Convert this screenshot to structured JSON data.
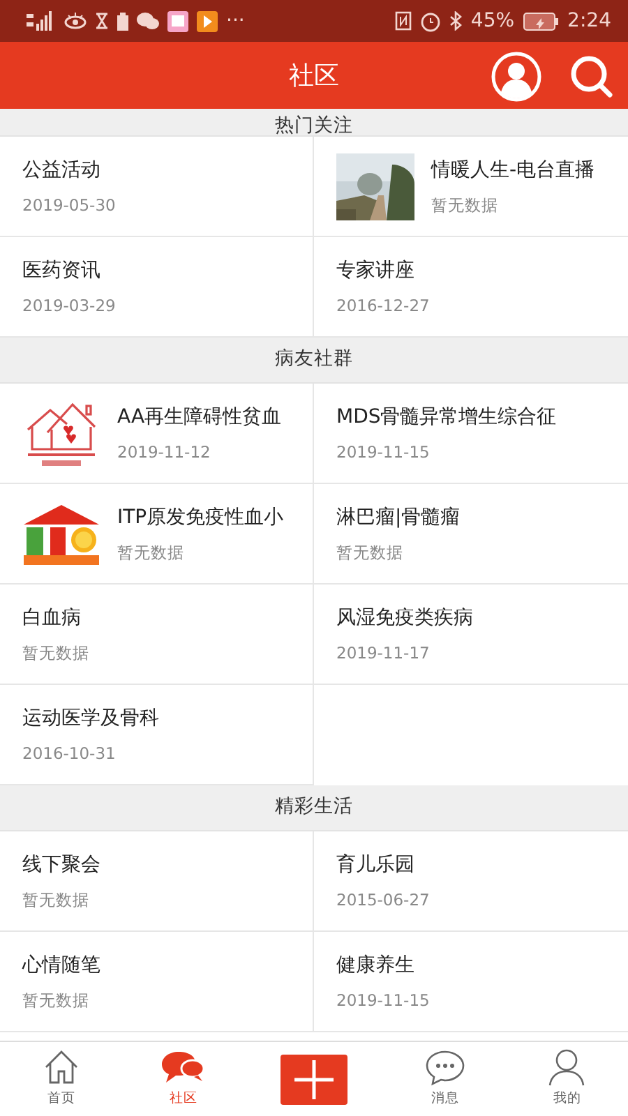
{
  "status_bar": {
    "more": "···",
    "battery": "45%",
    "time": "2:24"
  },
  "header": {
    "title": "社区"
  },
  "sections": [
    {
      "title": "热门关注",
      "cut": true,
      "items": [
        {
          "title": "公益活动",
          "subtitle": "2019-05-30"
        },
        {
          "title": "情暖人生-电台直播",
          "subtitle": "暂无数据",
          "kind": "picture"
        },
        {
          "title": "医药资讯",
          "subtitle": "2019-03-29"
        },
        {
          "title": "专家讲座",
          "subtitle": "2016-12-27"
        }
      ]
    },
    {
      "title": "病友社群",
      "cut": false,
      "items": [
        {
          "title": "AA再生障碍性贫血",
          "subtitle": "2019-11-12",
          "kind": "house-logo"
        },
        {
          "title": "MDS骨髓异常增生综合征",
          "subtitle": "2019-11-15"
        },
        {
          "title": "ITP原发免疫性血小",
          "subtitle": "暂无数据",
          "kind": "sun-house-logo"
        },
        {
          "title": "淋巴瘤|骨髓瘤",
          "subtitle": "暂无数据"
        },
        {
          "title": "白血病",
          "subtitle": "暂无数据"
        },
        {
          "title": "风湿免疫类疾病",
          "subtitle": "2019-11-17"
        },
        {
          "title": "运动医学及骨科",
          "subtitle": "2016-10-31"
        }
      ]
    },
    {
      "title": "精彩生活",
      "cut": false,
      "items": [
        {
          "title": "线下聚会",
          "subtitle": "暂无数据"
        },
        {
          "title": "育儿乐园",
          "subtitle": "2015-06-27"
        },
        {
          "title": "心情随笔",
          "subtitle": "暂无数据"
        },
        {
          "title": "健康养生",
          "subtitle": "2019-11-15"
        }
      ]
    }
  ],
  "nav": [
    {
      "kind": "home",
      "label": "首页",
      "selected": false
    },
    {
      "kind": "community",
      "label": "社区",
      "selected": true
    },
    {
      "kind": "add",
      "selected": false
    },
    {
      "kind": "messages",
      "label": "消息",
      "selected": false
    },
    {
      "kind": "profile",
      "label": "我的",
      "selected": false
    }
  ]
}
